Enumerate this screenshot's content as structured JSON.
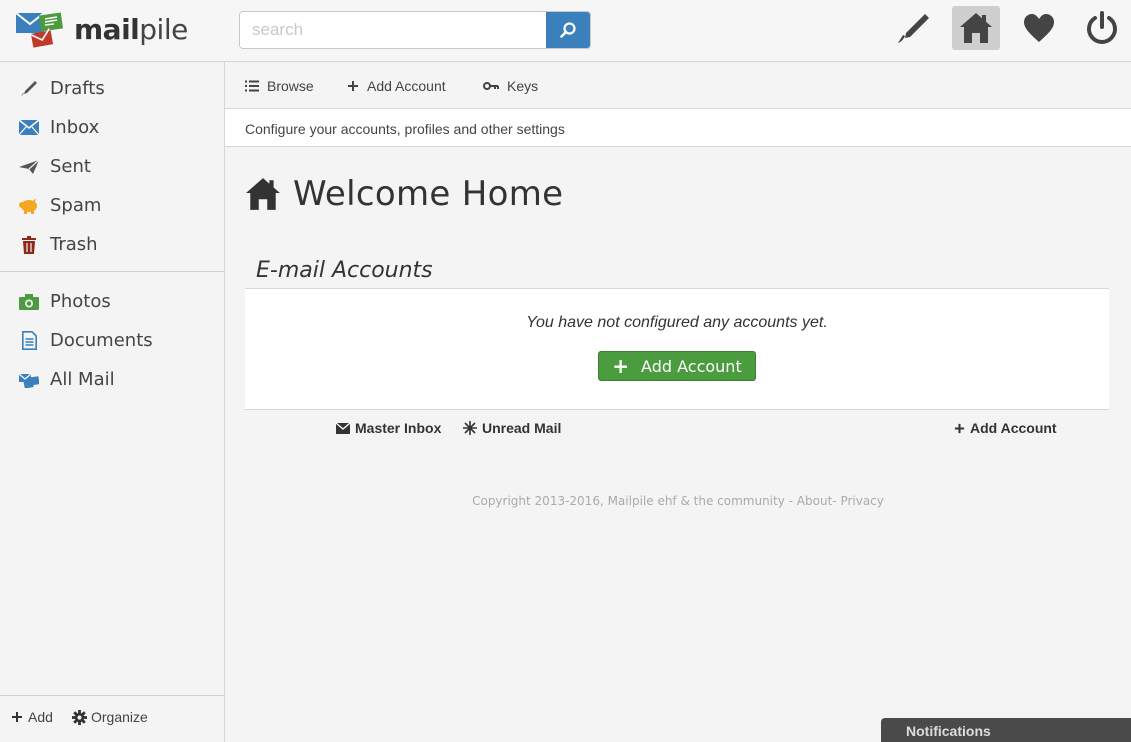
{
  "brand": {
    "name_bold": "mail",
    "name_rest": "pile"
  },
  "search": {
    "placeholder": "search",
    "value": ""
  },
  "top_icons": [
    "compose-icon",
    "home-icon",
    "heart-icon",
    "power-icon"
  ],
  "sidebar": {
    "items": [
      {
        "label": "Drafts",
        "icon": "pencil-icon",
        "color": "#555555"
      },
      {
        "label": "Inbox",
        "icon": "envelope-icon",
        "color": "#3a80bd"
      },
      {
        "label": "Sent",
        "icon": "paper-plane-icon",
        "color": "#555555"
      },
      {
        "label": "Spam",
        "icon": "pig-icon",
        "color": "#f5a623"
      },
      {
        "label": "Trash",
        "icon": "trash-icon",
        "color": "#8b2a1a"
      }
    ],
    "tags": [
      {
        "label": "Photos",
        "icon": "camera-icon",
        "color": "#4b9b3f"
      },
      {
        "label": "Documents",
        "icon": "document-icon",
        "color": "#3a80bd"
      },
      {
        "label": "All Mail",
        "icon": "mail-stack-icon",
        "color": "#3a80bd"
      }
    ],
    "bottom": {
      "add_label": "Add",
      "organize_label": "Organize"
    }
  },
  "subnav": {
    "browse": "Browse",
    "add_account": "Add Account",
    "keys": "Keys"
  },
  "subtitle": "Configure your accounts, profiles and other settings",
  "main": {
    "title": "Welcome Home",
    "accounts_heading": "E-mail Accounts",
    "empty_message": "You have not configured any accounts yet.",
    "add_account_button": "Add Account",
    "quick_links": {
      "master_inbox": "Master Inbox",
      "unread_mail": "Unread Mail",
      "add_account": "Add Account"
    }
  },
  "footer": {
    "copyright": "Copyright 2013-2016, Mailpile ehf & the community",
    "sep1": " - ",
    "about": "About",
    "sep2": "- ",
    "privacy": "Privacy"
  },
  "notifications_label": "Notifications",
  "colors": {
    "accent": "#3a80bd",
    "success": "#4b9b3f"
  }
}
